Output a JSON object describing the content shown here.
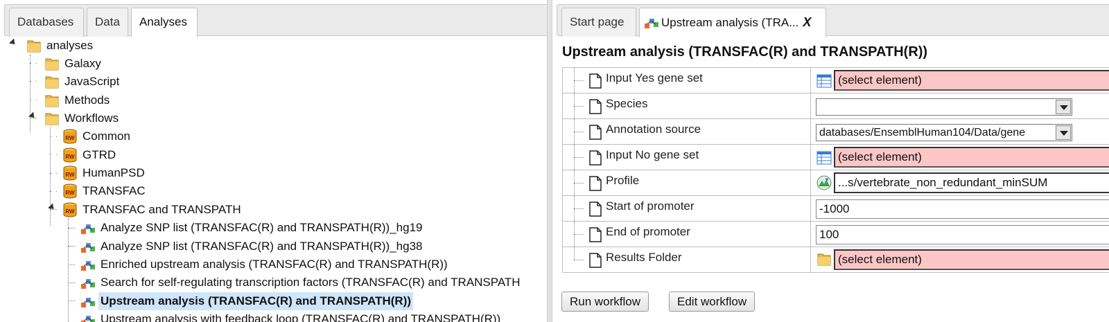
{
  "left_panel": {
    "tabs": [
      "Databases",
      "Data",
      "Analyses"
    ],
    "active_tab": "Analyses",
    "tree": {
      "root": "analyses",
      "groups": [
        "Galaxy",
        "JavaScript",
        "Methods",
        "Workflows"
      ],
      "workflows": [
        "Common",
        "GTRD",
        "HumanPSD",
        "TRANSFAC",
        "TRANSFAC and TRANSPATH"
      ],
      "items": [
        "Analyze SNP list (TRANSFAC(R) and TRANSPATH(R))_hg19",
        "Analyze SNP list (TRANSFAC(R) and TRANSPATH(R))_hg38",
        "Enriched upstream analysis (TRANSFAC(R) and TRANSPATH(R))",
        "Search for self-regulating transcription factors (TRANSFAC(R) and TRANSPATH",
        "Upstream analysis (TRANSFAC(R) and TRANSPATH(R))",
        "Upstream analysis with feedback loop (TRANSFAC(R) and TRANSPATH(R))"
      ],
      "selected_item": "Upstream analysis (TRANSFAC(R) and TRANSPATH(R))"
    }
  },
  "right_panel": {
    "tabs": [
      {
        "label": "Start page",
        "active": false
      },
      {
        "label": "Upstream analysis (TRA...",
        "active": true,
        "close": "X"
      }
    ],
    "heading": "Upstream analysis (TRANSFAC(R) and TRANSPATH(R))",
    "params": [
      {
        "name": "Input Yes gene set",
        "kind": "element",
        "value": "(select element)",
        "icon": "table-icon"
      },
      {
        "name": "Species",
        "kind": "select",
        "value": ""
      },
      {
        "name": "Annotation source",
        "kind": "select",
        "value": "databases/EnsemblHuman104/Data/gene"
      },
      {
        "name": "Input No gene set",
        "kind": "element",
        "value": "(select element)",
        "icon": "table-icon"
      },
      {
        "name": "Profile",
        "kind": "element-filled",
        "value": "...s/vertebrate_non_redundant_minSUM",
        "icon": "profile-icon"
      },
      {
        "name": "Start of promoter",
        "kind": "text",
        "value": "-1000"
      },
      {
        "name": "End of promoter",
        "kind": "text",
        "value": "100"
      },
      {
        "name": "Results Folder",
        "kind": "element",
        "value": "(select element)",
        "icon": "folder-icon"
      }
    ],
    "buttons": {
      "run": "Run workflow",
      "edit": "Edit workflow"
    }
  },
  "colors": {
    "selected_bg": "#cfe5f9",
    "empty_required_bg": "#fbc6c6",
    "folder": "#e8b94a",
    "repository": "#f0a020"
  }
}
